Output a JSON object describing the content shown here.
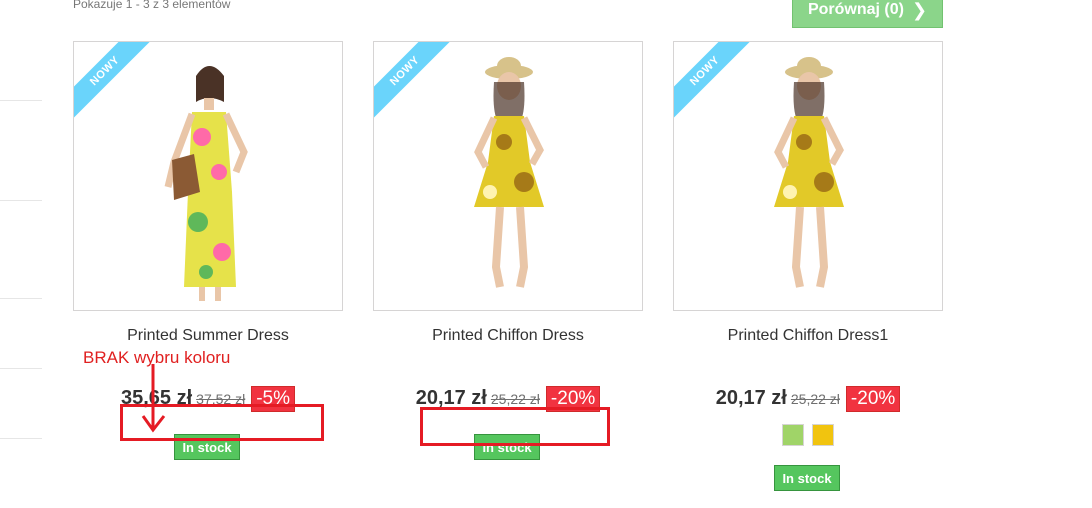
{
  "listing": {
    "count_text": "Pokazuje 1 - 3 z 3 elementów",
    "compare_label": "Porównaj (0)"
  },
  "products": [
    {
      "badge": "NOWY",
      "name": "Printed Summer Dress",
      "price": "35,65 zł",
      "old_price": "37,52 zł",
      "discount": "-5%",
      "stock": "In stock",
      "colors": []
    },
    {
      "badge": "NOWY",
      "name": "Printed Chiffon Dress",
      "price": "20,17 zł",
      "old_price": "25,22 zł",
      "discount": "-20%",
      "stock": "In stock",
      "colors": []
    },
    {
      "badge": "NOWY",
      "name": "Printed Chiffon Dress1",
      "price": "20,17 zł",
      "old_price": "25,22 zł",
      "discount": "-20%",
      "stock": "In stock",
      "colors": [
        "#a0d468",
        "#f1c40f"
      ]
    }
  ],
  "annotation": {
    "text": "BRAK wybru koloru",
    "color": "#e51b24"
  },
  "theme": {
    "compare_green": "#8bd58a",
    "stock_green": "#55c65e",
    "discount_red": "#f13340",
    "badge_blue": "#6ad4fb"
  }
}
